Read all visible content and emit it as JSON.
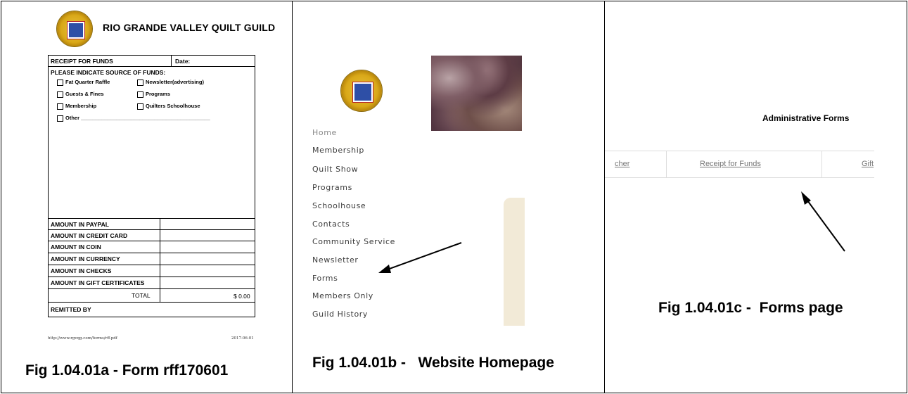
{
  "fig_a": {
    "guild_title": "RIO GRANDE VALLEY QUILT GUILD",
    "receipt_label": "RECEIPT FOR FUNDS",
    "date_label": "Date:",
    "source_label": "PLEASE INDICATE SOURCE OF FUNDS:",
    "checkboxes": [
      "Fat Quarter Raffle",
      "Newsletter(advertising)",
      "Guests & Fines",
      "Programs",
      "Membership",
      "Quilters Schoolhouse"
    ],
    "other_label": "Other ____________________________________________",
    "amount_rows": [
      "AMOUNT IN PAYPAL",
      "AMOUNT IN CREDIT CARD",
      "AMOUNT IN COIN",
      "AMOUNT IN CURRENCY",
      "AMOUNT IN CHECKS",
      "AMOUNT IN GIFT CERTIFICATES"
    ],
    "total_label": "TOTAL",
    "total_value": "$ 0.00",
    "remitted_label": "REMITTED BY",
    "footer_url": "http://www.rgvqg.com/forms/rff.pdf",
    "footer_date": "2017-06-01",
    "caption": "Fig 1.04.01a - Form rff170601"
  },
  "fig_b": {
    "nav_items": [
      "Home",
      "Membership",
      "Quilt Show",
      "Programs",
      "Schoolhouse",
      "Contacts",
      "Community Service",
      "Newsletter",
      "Forms",
      "Members Only",
      "Guild History"
    ],
    "caption": "Fig 1.04.01b -   Website Homepage"
  },
  "fig_c": {
    "page_title": "Administrative Forms",
    "tabs": [
      "cher",
      "Receipt for Funds",
      "Gift"
    ],
    "caption": "Fig 1.04.01c -  Forms page"
  },
  "colors": {
    "arrow": "#000000",
    "beige_panel": "#f2ead7",
    "seal_gold": "#d9a818"
  }
}
